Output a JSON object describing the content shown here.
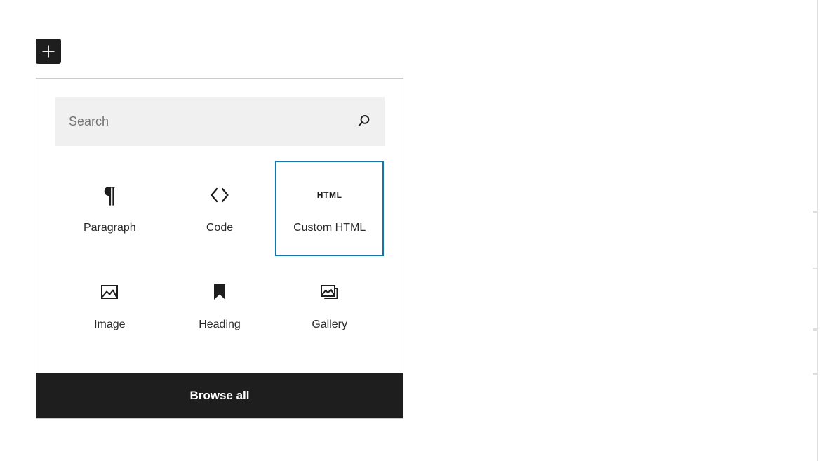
{
  "inserter": {
    "toggle_icon": "plus-icon",
    "search": {
      "placeholder": "Search",
      "value": "",
      "icon": "search-icon"
    },
    "blocks": [
      {
        "label": "Paragraph",
        "icon": "pilcrow-icon",
        "selected": false
      },
      {
        "label": "Code",
        "icon": "code-brackets-icon",
        "selected": false
      },
      {
        "label": "Custom HTML",
        "icon": "html-text-icon",
        "selected": true
      },
      {
        "label": "Image",
        "icon": "image-icon",
        "selected": false
      },
      {
        "label": "Heading",
        "icon": "bookmark-icon",
        "selected": false
      },
      {
        "label": "Gallery",
        "icon": "gallery-icon",
        "selected": false
      }
    ],
    "html_icon_text": "HTML",
    "browse_all_label": "Browse all"
  },
  "colors": {
    "selected_border": "#1078ad",
    "footer_background": "#1e1e1e",
    "search_background": "#f0f0f0",
    "panel_border": "#cccccc",
    "placeholder_text": "#757575"
  }
}
